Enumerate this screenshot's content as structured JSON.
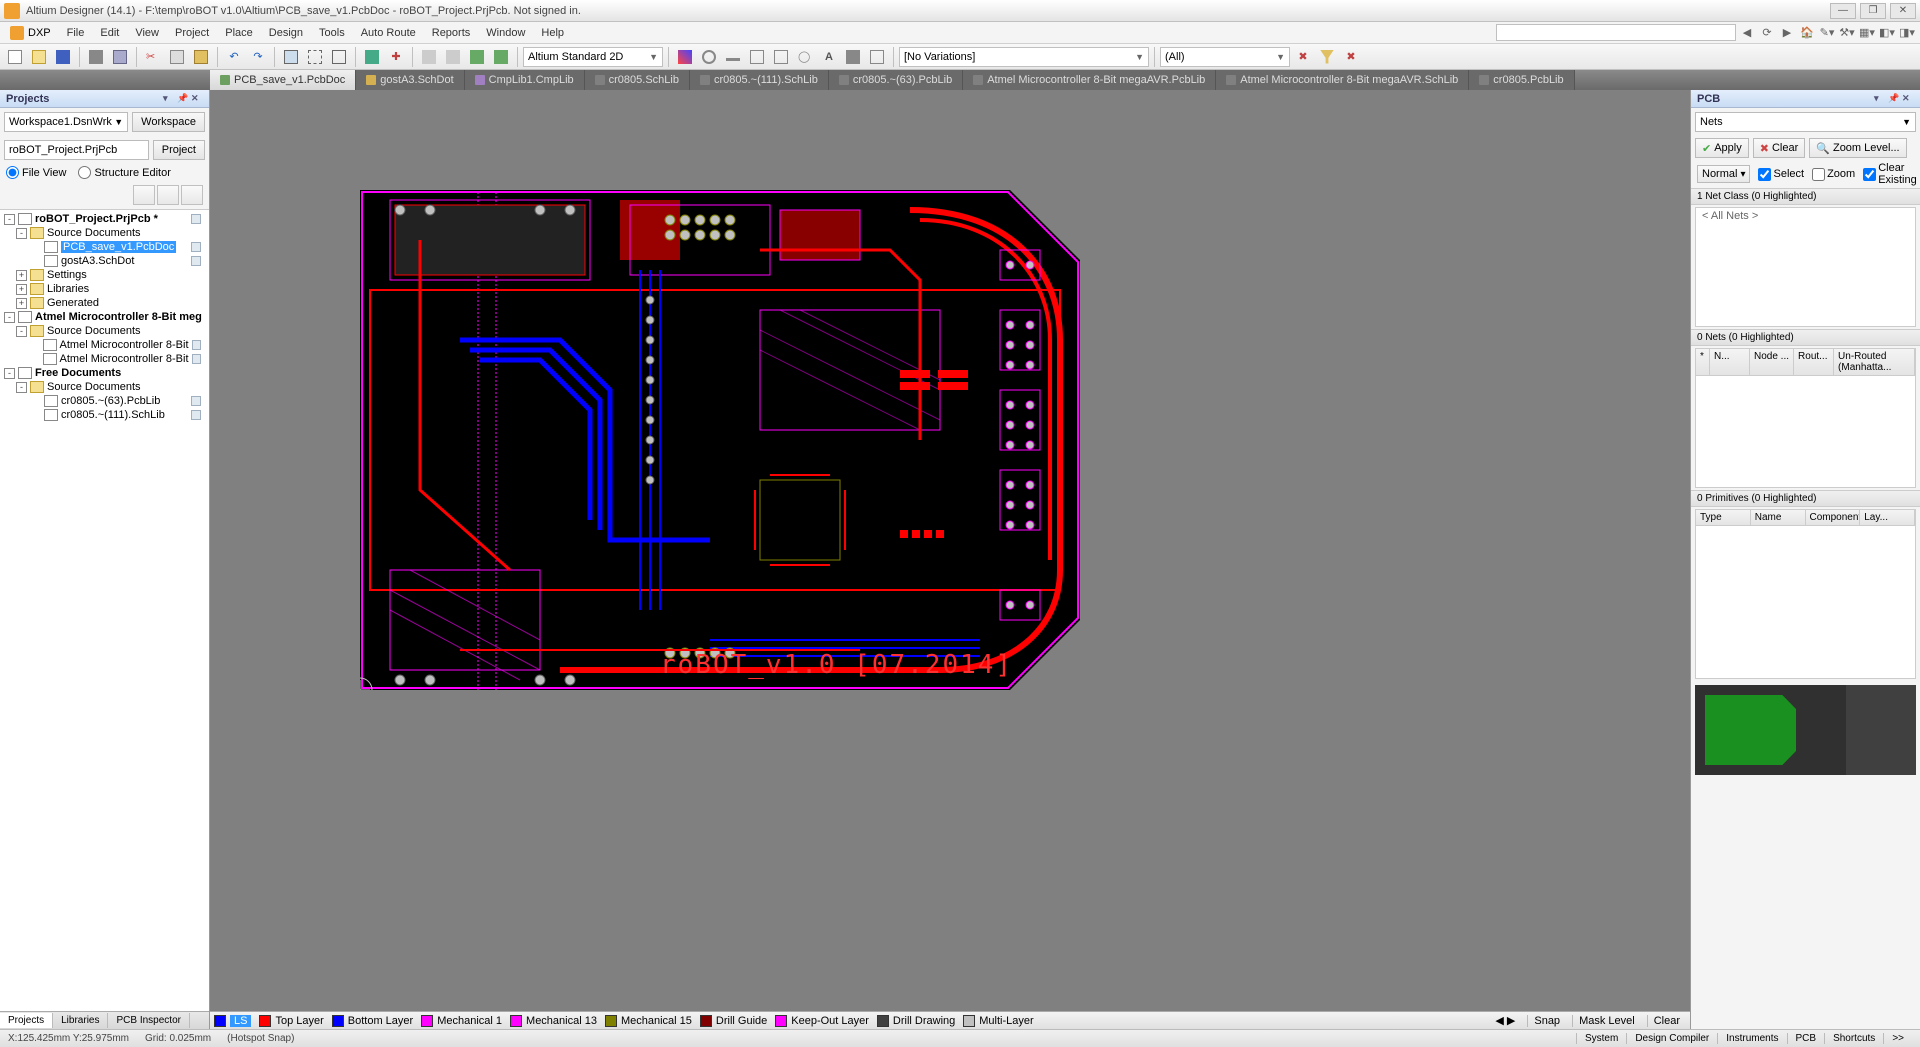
{
  "titlebar": {
    "text": "Altium Designer (14.1) - F:\\temp\\roBOT v1.0\\Altium\\PCB_save_v1.PcbDoc - roBOT_Project.PrjPcb. Not signed in."
  },
  "menu": {
    "dxp": "DXP",
    "items": [
      "File",
      "Edit",
      "View",
      "Project",
      "Place",
      "Design",
      "Tools",
      "Auto Route",
      "Reports",
      "Window",
      "Help"
    ]
  },
  "toolbar": {
    "viewmode": "Altium Standard 2D",
    "variations": "[No Variations]",
    "filter": "(All)"
  },
  "doctabs": [
    {
      "label": "PCB_save_v1.PcbDoc",
      "active": true,
      "color": "#6da060"
    },
    {
      "label": "gostA3.SchDot",
      "active": false,
      "color": "#d4b050"
    },
    {
      "label": "CmpLib1.CmpLib",
      "active": false,
      "color": "#a080c0"
    },
    {
      "label": "cr0805.SchLib",
      "active": false,
      "color": "#808080"
    },
    {
      "label": "cr0805.~(111).SchLib",
      "active": false,
      "color": "#808080"
    },
    {
      "label": "cr0805.~(63).PcbLib",
      "active": false,
      "color": "#808080"
    },
    {
      "label": "Atmel Microcontroller 8-Bit megaAVR.PcbLib",
      "active": false,
      "color": "#808080"
    },
    {
      "label": "Atmel Microcontroller 8-Bit megaAVR.SchLib",
      "active": false,
      "color": "#808080"
    },
    {
      "label": "cr0805.PcbLib",
      "active": false,
      "color": "#808080"
    }
  ],
  "projects": {
    "title": "Projects",
    "workspace": "Workspace1.DsnWrk",
    "workspace_btn": "Workspace",
    "project": "roBOT_Project.PrjPcb",
    "project_btn": "Project",
    "view_file": "File View",
    "view_struct": "Structure Editor",
    "tree": [
      {
        "lvl": 0,
        "tw": "-",
        "icon": "project",
        "label": "roBOT_Project.PrjPcb *",
        "bold": true,
        "book": true
      },
      {
        "lvl": 1,
        "tw": "-",
        "icon": "folder",
        "label": "Source Documents"
      },
      {
        "lvl": 2,
        "tw": "",
        "icon": "pcb",
        "label": "PCB_save_v1.PcbDoc",
        "selected": true,
        "book": true
      },
      {
        "lvl": 2,
        "tw": "",
        "icon": "sch",
        "label": "gostA3.SchDot",
        "book": true
      },
      {
        "lvl": 1,
        "tw": "+",
        "icon": "folder",
        "label": "Settings"
      },
      {
        "lvl": 1,
        "tw": "+",
        "icon": "folder",
        "label": "Libraries"
      },
      {
        "lvl": 1,
        "tw": "+",
        "icon": "folder",
        "label": "Generated"
      },
      {
        "lvl": 0,
        "tw": "-",
        "icon": "project",
        "label": "Atmel Microcontroller 8-Bit meg",
        "bold": true
      },
      {
        "lvl": 1,
        "tw": "-",
        "icon": "folder",
        "label": "Source Documents"
      },
      {
        "lvl": 2,
        "tw": "",
        "icon": "lib",
        "label": "Atmel Microcontroller 8-Bit",
        "book": true
      },
      {
        "lvl": 2,
        "tw": "",
        "icon": "lib",
        "label": "Atmel Microcontroller 8-Bit",
        "book": true
      },
      {
        "lvl": 0,
        "tw": "-",
        "icon": "project",
        "label": "Free Documents",
        "bold": true
      },
      {
        "lvl": 1,
        "tw": "-",
        "icon": "folder",
        "label": "Source Documents"
      },
      {
        "lvl": 2,
        "tw": "",
        "icon": "lib",
        "label": "cr0805.~(63).PcbLib",
        "book": true
      },
      {
        "lvl": 2,
        "tw": "",
        "icon": "lib",
        "label": "cr0805.~(111).SchLib",
        "book": true
      }
    ]
  },
  "bottomtabs_left": [
    "Projects",
    "Libraries",
    "PCB Inspector"
  ],
  "layers": [
    {
      "label": "LS",
      "color": "#0000ff",
      "active": true
    },
    {
      "label": "Top Layer",
      "color": "#ff0000"
    },
    {
      "label": "Bottom Layer",
      "color": "#0000ff"
    },
    {
      "label": "Mechanical 1",
      "color": "#ff00ff"
    },
    {
      "label": "Mechanical 13",
      "color": "#ff00ff"
    },
    {
      "label": "Mechanical 15",
      "color": "#808000"
    },
    {
      "label": "Drill Guide",
      "color": "#800000"
    },
    {
      "label": "Keep-Out Layer",
      "color": "#ff00ff"
    },
    {
      "label": "Drill Drawing",
      "color": "#404040"
    },
    {
      "label": "Multi-Layer",
      "color": "#c0c0c0"
    }
  ],
  "layerbar_right": {
    "snap": "Snap",
    "mask": "Mask Level",
    "clear": "Clear"
  },
  "pcb_silk": "roBOT_v1.0  [07.2014]",
  "pcbpanel": {
    "title": "PCB",
    "mode": "Nets",
    "apply": "Apply",
    "clear": "Clear",
    "zoom": "Zoom Level...",
    "normal": "Normal",
    "chk_select": "Select",
    "chk_zoom": "Zoom",
    "chk_clear": "Clear Existing",
    "sec1": "1 Net Class (0 Highlighted)",
    "allnets": "< All Nets >",
    "sec2": "0 Nets (0 Highlighted)",
    "cols2": [
      "*",
      "N...",
      "Node ...",
      "Rout...",
      "Un-Routed (Manhatta..."
    ],
    "sec3": "0 Primitives (0 Highlighted)",
    "cols3": [
      "Type",
      "Name",
      "Component",
      "Lay..."
    ]
  },
  "statusbar": {
    "coords": "X:125.425mm Y:25.975mm",
    "grid": "Grid: 0.025mm",
    "snap": "(Hotspot Snap)",
    "right": [
      "System",
      "Design Compiler",
      "Instruments",
      "PCB",
      "Shortcuts",
      ">>"
    ]
  }
}
